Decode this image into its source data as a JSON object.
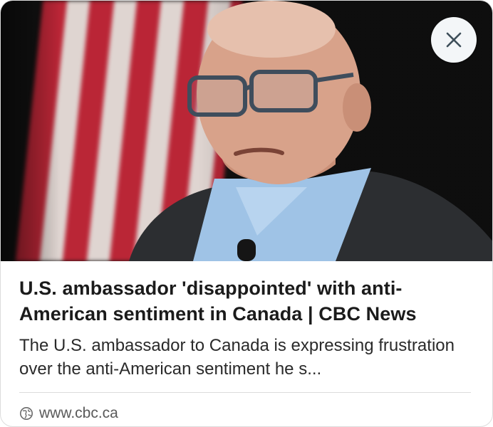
{
  "preview": {
    "title": "U.S. ambassador 'disappointed' with anti-American sentiment in Canada | CBC News",
    "description": "The U.S. ambassador to Canada is expressing frustration over the anti-American sentiment he s...",
    "source": "www.cbc.ca"
  },
  "icons": {
    "close": "close-icon",
    "globe": "globe-icon"
  },
  "colors": {
    "flag_red": "#c9283a",
    "flag_white": "#f1e6e2",
    "background_dark": "#121212",
    "close_bg": "#f3f6f8",
    "close_glyph": "#3e4f5a",
    "title_text": "#1b1b1b",
    "source_text": "#5a5a5a"
  }
}
